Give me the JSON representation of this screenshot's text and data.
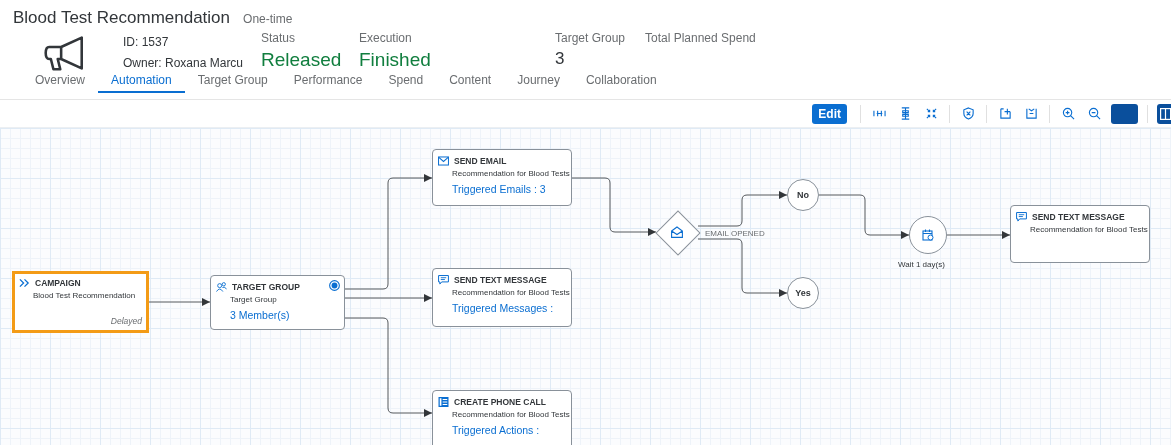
{
  "header": {
    "title": "Blood Test Recommendation",
    "type": "One-time",
    "id": "ID: 1537",
    "owner": "Owner: Roxana Marcu",
    "facts": [
      {
        "label": "Status",
        "value": "Released",
        "kind": "status"
      },
      {
        "label": "Execution",
        "value": "Finished",
        "kind": "status"
      },
      {
        "label": "Target Group",
        "value": "3",
        "kind": "plain"
      },
      {
        "label": "Total Planned Spend"
      }
    ]
  },
  "tabs": [
    {
      "label": "Overview",
      "selected": false
    },
    {
      "label": "Automation",
      "selected": true
    },
    {
      "label": "Target Group",
      "selected": false
    },
    {
      "label": "Performance",
      "selected": false
    },
    {
      "label": "Spend",
      "selected": false
    },
    {
      "label": "Content",
      "selected": false
    },
    {
      "label": "Journey",
      "selected": false
    },
    {
      "label": "Collaboration",
      "selected": false
    }
  ],
  "toolbar": {
    "edit": "Edit"
  },
  "nodes": [
    {
      "kind": "campaign",
      "title": "CAMPAIGN",
      "subtitle": "Blood Test Recommendation",
      "status": "Delayed",
      "selected": true
    },
    {
      "kind": "group",
      "title": "TARGET GROUP",
      "subtitle": "Target Group",
      "metric": "3 Member(s)",
      "selected": false
    },
    {
      "kind": "email",
      "title": "SEND EMAIL",
      "subtitle": "Recommendation for Blood Tests",
      "metric": "Triggered Emails : 3",
      "selected": false
    },
    {
      "kind": "sms",
      "title": "SEND TEXT MESSAGE",
      "subtitle": "Recommendation for Blood Tests",
      "metric": "Triggered Messages :",
      "selected": false
    },
    {
      "kind": "call",
      "title": "CREATE PHONE CALL",
      "subtitle": "Recommendation for Blood Tests",
      "metric": "Triggered Actions :",
      "selected": false
    },
    {
      "kind": "decision",
      "label": "EMAIL OPENED"
    },
    {
      "kind": "outcome",
      "label": "No"
    },
    {
      "kind": "outcome",
      "label": "Yes"
    },
    {
      "kind": "wait",
      "label": "Wait 1 day(s)"
    },
    {
      "kind": "sms",
      "title": "SEND TEXT MESSAGE",
      "subtitle": "Recommendation for Blood Tests",
      "selected": false
    }
  ]
}
